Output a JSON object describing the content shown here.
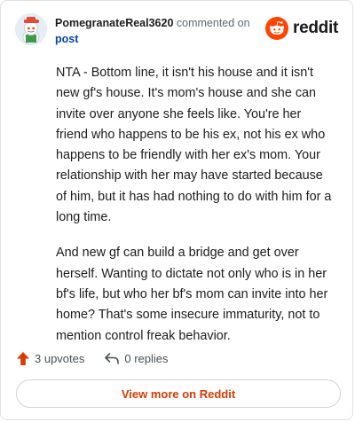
{
  "comment": {
    "username": "PomegranateReal3620",
    "action_text": "commented on",
    "post_link": "post",
    "paragraphs": [
      "NTA - Bottom line, it isn't his house and it isn't new gf's house. It's mom's house and she can invite over anyone she feels like. You're her friend who happens to be his ex, not his ex who happens to be friendly with her ex's mom. Your relationship with her may have started because of him, but it has had nothing to do with him for a long time.",
      "And new gf can build a bridge and get over herself. Wanting to dictate not only who is in her bf's life, but who her bf's mom can invite into her home? That's some insecure immaturity, not to mention control freak behavior."
    ]
  },
  "brand": {
    "name": "reddit",
    "color": "#ff4500"
  },
  "footer": {
    "upvotes": "3 upvotes",
    "replies": "0 replies",
    "view_more": "View more on Reddit"
  },
  "icons": {
    "avatar": "snoo-avatar",
    "logo": "reddit-logo-icon",
    "upvote": "upvote-arrow-icon",
    "reply": "reply-arrow-icon"
  }
}
